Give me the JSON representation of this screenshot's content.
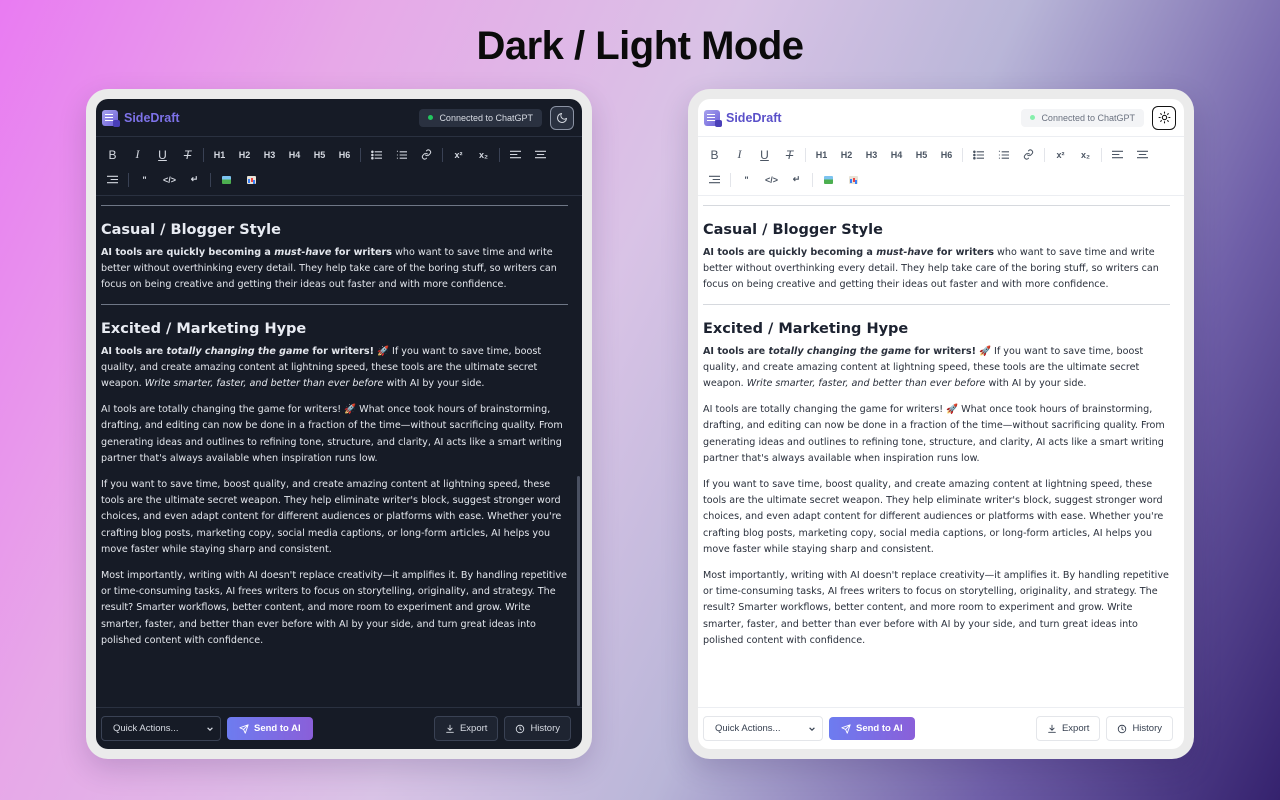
{
  "headline": "Dark / Light Mode",
  "app": {
    "brand": "SideDraft",
    "status": "Connected to ChatGPT"
  },
  "toolbar": {
    "bold": "B",
    "italic": "I",
    "underline": "U",
    "clear": "T",
    "h1": "H1",
    "h2": "H2",
    "h3": "H3",
    "h4": "H4",
    "h5": "H5",
    "h6": "H6",
    "superscript": "x²",
    "subscript": "x₂",
    "quote": "\"",
    "code": "</>",
    "break": "↵"
  },
  "content": {
    "casual_heading": "Casual / Blogger Style",
    "casual_p1_b1": "AI tools are quickly becoming a ",
    "casual_p1_em": "must-have",
    "casual_p1_b2": " for writers",
    "casual_p1_rest": " who want to save time and write better without overthinking every detail. They help take care of the boring stuff, so writers can focus on being creative and getting their ideas out faster and with more confidence.",
    "hype_heading": "Excited / Marketing Hype",
    "hype_p1_b1": "AI tools are ",
    "hype_p1_em": "totally changing the game",
    "hype_p1_b2": " for writers!",
    "hype_p1_mid": " 🚀 If you want to save time, boost quality, and create amazing content at lightning speed, these tools are the ultimate secret weapon. ",
    "hype_p1_em2": "Write smarter, faster, and better than ever before",
    "hype_p1_end": " with AI by your side.",
    "hype_p2": "AI tools are totally changing the game for writers! 🚀 What once took hours of brainstorming, drafting, and editing can now be done in a fraction of the time—without sacrificing quality. From generating ideas and outlines to refining tone, structure, and clarity, AI acts like a smart writing partner that's always available when inspiration runs low.",
    "hype_p3": "If you want to save time, boost quality, and create amazing content at lightning speed, these tools are the ultimate secret weapon. They help eliminate writer's block, suggest stronger word choices, and even adapt content for different audiences or platforms with ease. Whether you're crafting blog posts, marketing copy, social media captions, or long-form articles, AI helps you move faster while staying sharp and consistent.",
    "hype_p4": "Most importantly, writing with AI doesn't replace creativity—it amplifies it. By handling repetitive or time-consuming tasks, AI frees writers to focus on storytelling, originality, and strategy. The result? Smarter workflows, better content, and more room to experiment and grow. Write smarter, faster, and better than ever before with AI by your side, and turn great ideas into polished content with confidence."
  },
  "footer": {
    "quick_actions": "Quick Actions...",
    "send": "Send to AI",
    "export": "Export",
    "history": "History"
  },
  "colors": {
    "accent": "#7d72e8",
    "dark_bg": "#161b26",
    "light_bg": "#ffffff",
    "status_dot": "#22c55e"
  },
  "icons": {
    "dark_mode_toggle": "moon-icon",
    "light_mode_toggle": "sun-icon"
  }
}
